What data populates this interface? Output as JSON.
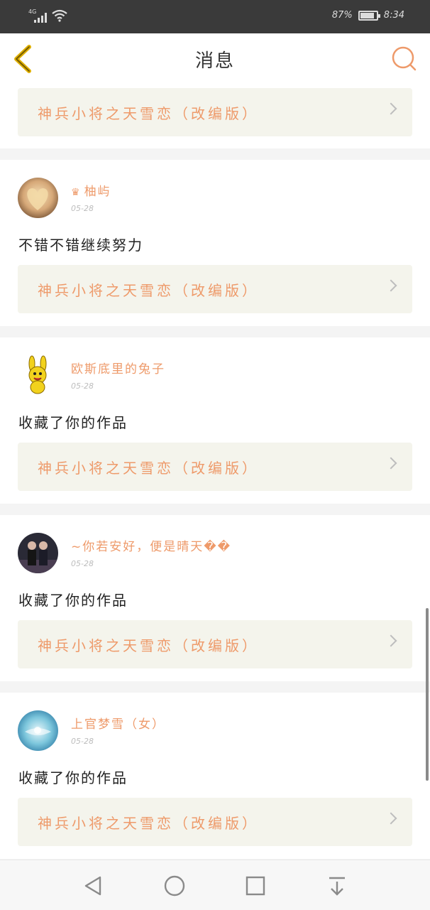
{
  "status_bar": {
    "network": "4G",
    "battery_text": "87%",
    "battery_level": 0.87,
    "time": "8:34"
  },
  "header": {
    "title": "消息",
    "back_icon": "chevron-left-icon",
    "search_icon": "search-icon"
  },
  "colors": {
    "accent": "#ee9a6a",
    "back_arrow": "#e0b000",
    "work_box_bg": "#f4f4ec"
  },
  "messages": [
    {
      "work_title": "神兵小将之天雪恋（改编版）"
    },
    {
      "user_name": "柚屿",
      "badge_icon": "crown-icon",
      "date": "05-28",
      "comment": "不错不错继续努力",
      "work_title": "神兵小将之天雪恋（改编版）"
    },
    {
      "user_name": "欧斯底里的兔子",
      "date": "05-28",
      "comment": "收藏了你的作品",
      "work_title": "神兵小将之天雪恋（改编版）"
    },
    {
      "user_name": "~你若安好，便是晴天��",
      "date": "05-28",
      "comment": "收藏了你的作品",
      "work_title": "神兵小将之天雪恋（改编版）"
    },
    {
      "user_name": "上官梦雪（女）",
      "date": "05-28",
      "comment": "收藏了你的作品",
      "work_title": "神兵小将之天雪恋（改编版）"
    }
  ],
  "nav_bar": {
    "back": "triangle-back-icon",
    "home": "circle-home-icon",
    "recents": "square-recents-icon",
    "notifications": "pull-down-icon"
  }
}
